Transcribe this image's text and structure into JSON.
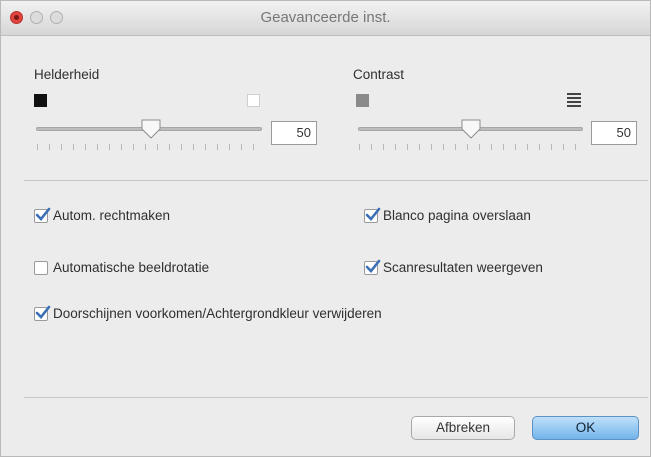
{
  "window": {
    "title": "Geavanceerde inst."
  },
  "brightness": {
    "label": "Helderheid",
    "value": "50",
    "level": 0.5,
    "min_icon": "black-square-icon",
    "max_icon": "white-square-icon"
  },
  "contrast": {
    "label": "Contrast",
    "value": "50",
    "level": 0.5,
    "min_icon": "gray-square-icon",
    "max_icon": "striped-square-icon"
  },
  "options": [
    {
      "label": "Autom. rechtmaken",
      "checked": true
    },
    {
      "label": "Blanco pagina overslaan",
      "checked": true
    },
    {
      "label": "Automatische beeldrotatie",
      "checked": false
    },
    {
      "label": "Scanresultaten weergeven",
      "checked": true
    },
    {
      "label": "Doorschijnen voorkomen/Achtergrondkleur verwijderen",
      "checked": true
    }
  ],
  "buttons": {
    "cancel": "Afbreken",
    "ok": "OK"
  },
  "colors": {
    "accent": "#72b4ea",
    "checkmark": "#3b6fb6",
    "close": "#e0443e"
  }
}
